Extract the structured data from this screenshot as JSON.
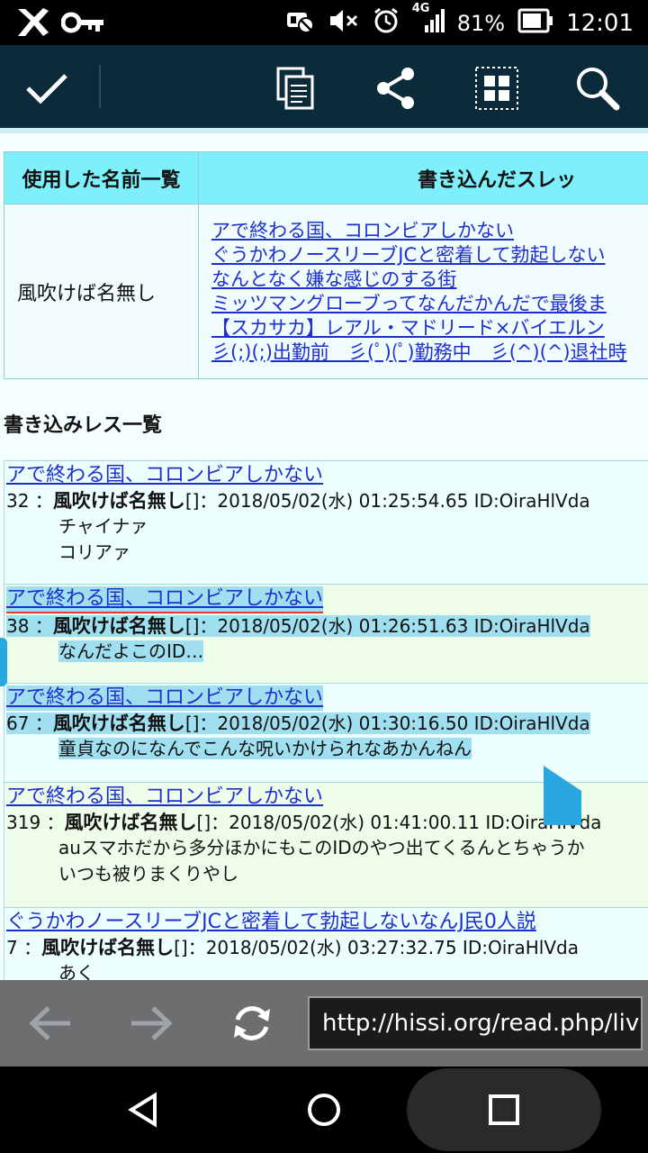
{
  "statusbar": {
    "battery_percent": "81%",
    "time": "12:01",
    "network": "4G",
    "icons": [
      "app-x-icon",
      "key-icon",
      "vibrate-off-icon",
      "mute-icon",
      "alarm-icon",
      "signal-icon",
      "battery-icon"
    ]
  },
  "toolbar": {
    "icons": [
      "check-icon",
      "copy-icon",
      "share-icon",
      "select-all-icon",
      "search-icon"
    ]
  },
  "names_table": {
    "col1_header": "使用した名前一覧",
    "col2_header": "書き込んだスレッ",
    "name": "風吹けば名無し",
    "threads": [
      "アで終わる国、コロンビアしかない",
      "ぐうかわノースリーブJCと密着して勃起しない",
      "なんとなく嫌な感じのする街",
      "ミッツマングローブってなんだかんだで最後ま",
      "【スカサカ】レアル・マドリード×バイエルン",
      "彡(;)(;)出勤前　彡(ﾟ)(ﾟ)勤務中　彡(^)(^)退社時"
    ]
  },
  "section_title": "書き込みレス一覧",
  "posts": [
    {
      "thread": "アで終わる国、コロンビアしかない",
      "number": "32",
      "name": "風吹けば名無し",
      "meta": "2018/05/02(水) 01:25:54.65 ID:OiraHlVda",
      "body": [
        "チャイナァ",
        "コリアァ"
      ]
    },
    {
      "thread": "アで終わる国、コロンビアしかない",
      "number": "38",
      "name": "風吹けば名無し",
      "meta": "2018/05/02(水) 01:26:51.63 ID:OiraHlVda",
      "body": [
        "なんだよこのID…"
      ]
    },
    {
      "thread": "アで終わる国、コロンビアしかない",
      "number": "67",
      "name": "風吹けば名無し",
      "meta": "2018/05/02(水) 01:30:16.50 ID:OiraHlVda",
      "body": [
        "童貞なのになんでこんな呪いかけられなあかんねん"
      ]
    },
    {
      "thread": "アで終わる国、コロンビアしかない",
      "number": "319",
      "name": "風吹けば名無し",
      "meta": "2018/05/02(水) 01:41:00.11 ID:OiraHlVda",
      "body": [
        "auスマホだから多分ほかにもこのIDのやつ出てくるんとちゃうか",
        "いつも被りまくりやし"
      ]
    },
    {
      "thread": "ぐうかわノースリーブJCと密着して勃起しないなんJ民0人説",
      "number": "7",
      "name": "風吹けば名無し",
      "meta": "2018/05/02(水) 03:27:32.75 ID:OiraHlVda",
      "body": [
        "あく"
      ]
    }
  ],
  "post_name_suffix": "[]",
  "browser": {
    "url": "http://hissi.org/read.php/liv",
    "icons": [
      "back-arrow-icon",
      "forward-arrow-icon",
      "refresh-icon"
    ]
  },
  "sysnav": {
    "icons": [
      "nav-back-icon",
      "home-icon",
      "recents-icon"
    ]
  },
  "colors": {
    "toolbar_bg": "#0b2b3a",
    "table_header": "#7ef0fb",
    "link": "#1d2fcf",
    "selection": "#9fdff0",
    "selection_handle": "#2aa7de"
  }
}
